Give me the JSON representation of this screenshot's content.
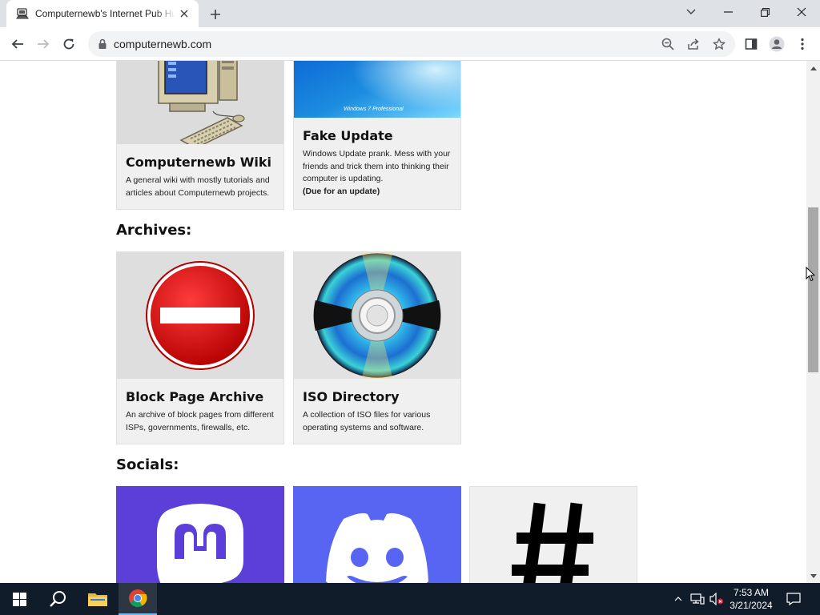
{
  "browser": {
    "tab_title": "Computernewb's Internet Pub Hub",
    "url": "computernewb.com"
  },
  "cards_top": [
    {
      "title": "Computernewb Wiki",
      "description": "A general wiki with mostly tutorials and articles about Computernewb projects.",
      "image": "retro-computer-icon"
    },
    {
      "title": "Fake Update",
      "description": "Windows Update prank. Mess with your friends and trick them into thinking their computer is updating.",
      "note": "(Due for an update)",
      "image_caption": "Windows 7 Professional",
      "image": "windows-7-wallpaper"
    }
  ],
  "sections": {
    "archives": "Archives:",
    "socials": "Socials:"
  },
  "archives": [
    {
      "title": "Block Page Archive",
      "description": "An archive of block pages from different ISPs, governments, firewalls, etc.",
      "image": "no-entry-sign-icon"
    },
    {
      "title": "ISO Directory",
      "description": "A collection of ISO files for various operating systems and software.",
      "image": "cd-disc-icon"
    }
  ],
  "socials": [
    {
      "image": "mastodon-logo-icon"
    },
    {
      "image": "discord-logo-icon"
    },
    {
      "image": "hashtag-icon"
    }
  ],
  "colors": {
    "mastodon": "#5b3fd8",
    "discord": "#5865f2",
    "card_bg": "#f0f0f0",
    "taskbar": "#101c2a"
  },
  "taskbar": {
    "time": "7:53 AM",
    "date": "3/21/2024"
  }
}
